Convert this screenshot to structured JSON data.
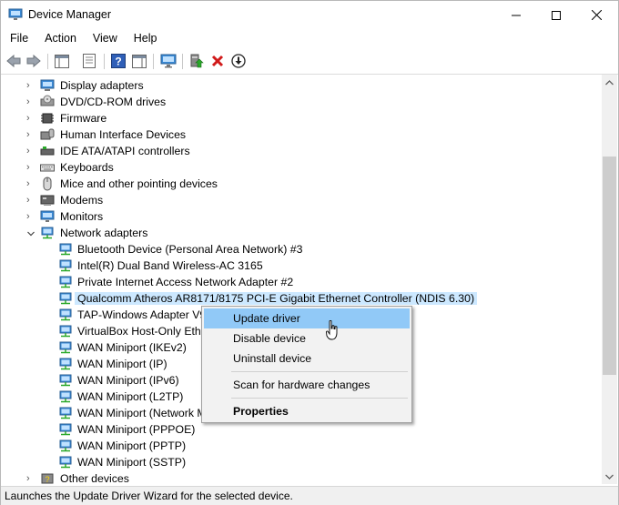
{
  "window": {
    "title": "Device Manager"
  },
  "menubar": {
    "items": [
      "File",
      "Action",
      "View",
      "Help"
    ]
  },
  "toolbar": {
    "buttons": [
      "back-icon",
      "forward-icon",
      "properties-icon",
      "show-hide-icon",
      "help-icon",
      "action-icon",
      "monitor-icon",
      "update-driver-icon",
      "uninstall-icon",
      "download-icon"
    ]
  },
  "tree": {
    "categories_top": [
      {
        "label": "Display adapters",
        "icon": "display-adapter-icon"
      },
      {
        "label": "DVD/CD-ROM drives",
        "icon": "dvd-drive-icon"
      },
      {
        "label": "Firmware",
        "icon": "firmware-icon"
      },
      {
        "label": "Human Interface Devices",
        "icon": "hid-icon"
      },
      {
        "label": "IDE ATA/ATAPI controllers",
        "icon": "ide-controller-icon"
      },
      {
        "label": "Keyboards",
        "icon": "keyboard-icon"
      },
      {
        "label": "Mice and other pointing devices",
        "icon": "mouse-icon"
      },
      {
        "label": "Modems",
        "icon": "modem-icon"
      },
      {
        "label": "Monitors",
        "icon": "monitor-icon"
      }
    ],
    "network_adapters": {
      "label": "Network adapters",
      "children": [
        "Bluetooth Device (Personal Area Network) #3",
        "Intel(R) Dual Band Wireless-AC 3165",
        "Private Internet Access Network Adapter #2",
        "Qualcomm Atheros AR8171/8175 PCI-E Gigabit Ethernet Controller (NDIS 6.30)",
        "TAP-Windows Adapter V9",
        "VirtualBox Host-Only Ethe",
        "WAN Miniport (IKEv2)",
        "WAN Miniport (IP)",
        "WAN Miniport (IPv6)",
        "WAN Miniport (L2TP)",
        "WAN Miniport (Network M",
        "WAN Miniport (PPPOE)",
        "WAN Miniport (PPTP)",
        "WAN Miniport (SSTP)"
      ],
      "selected_index": 3
    },
    "other_devices": {
      "label": "Other devices"
    }
  },
  "context_menu": {
    "items": [
      {
        "label": "Update driver",
        "hover": true
      },
      {
        "label": "Disable device"
      },
      {
        "label": "Uninstall device"
      },
      {
        "label": "Scan for hardware changes"
      },
      {
        "label": "Properties",
        "bold": true
      }
    ]
  },
  "statusbar": {
    "text": "Launches the Update Driver Wizard for the selected device."
  },
  "colors": {
    "selection": "#cce8ff",
    "menu_hover": "#91c9f7",
    "menu_bg": "#f2f2f2"
  }
}
